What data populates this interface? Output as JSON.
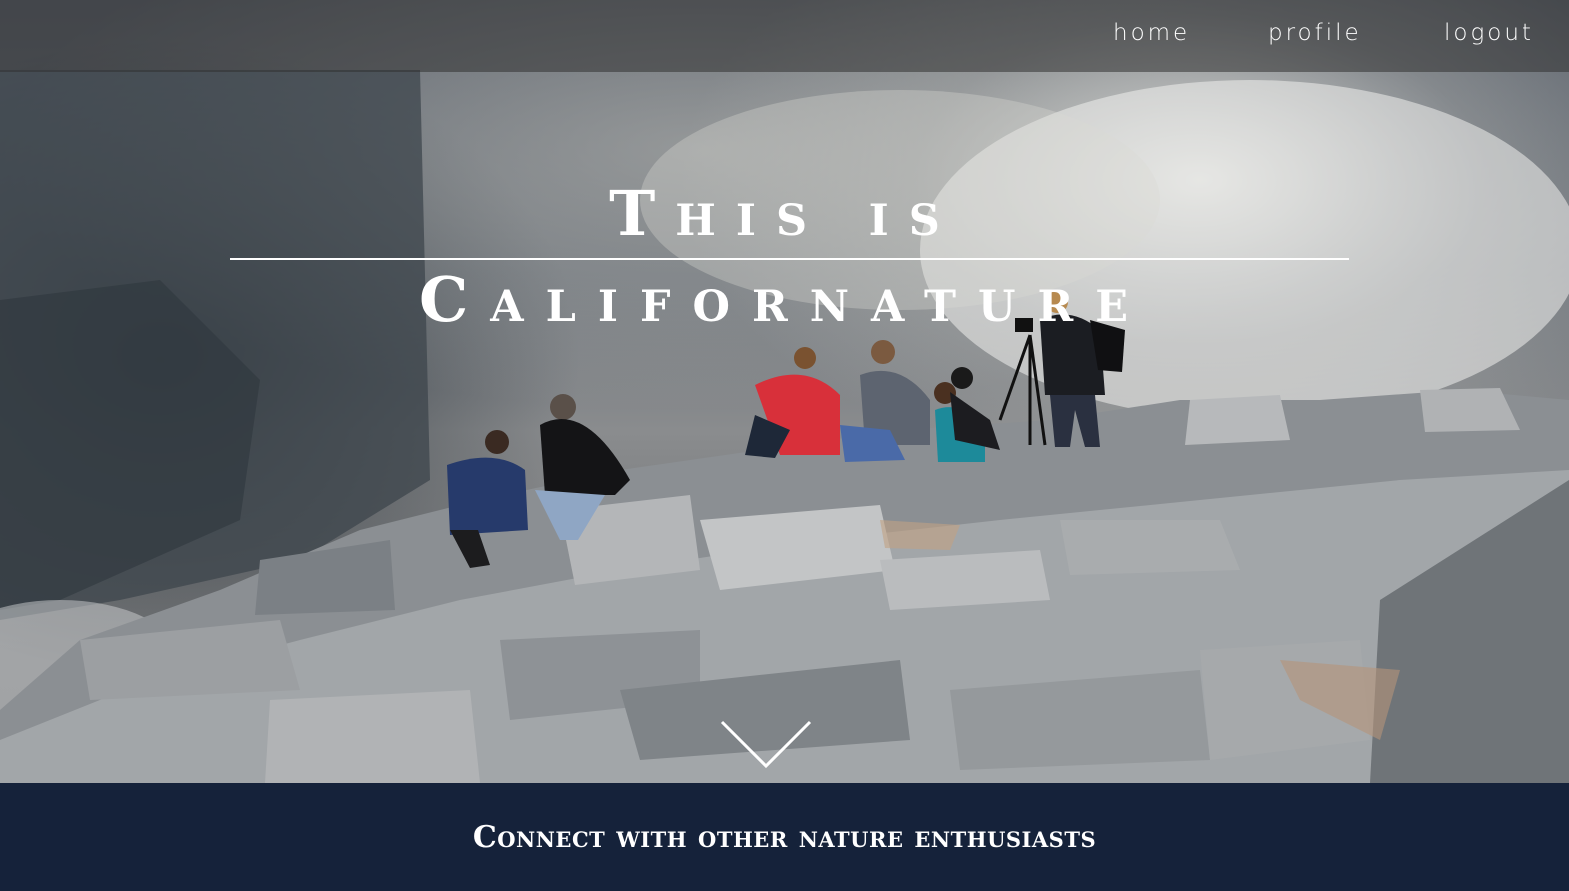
{
  "nav": {
    "home": "home",
    "profile": "profile",
    "logout": "logout"
  },
  "hero": {
    "title_line1": "This is",
    "title_line2": "Californature"
  },
  "tagline": "Connect with other nature enthusiasts",
  "colors": {
    "band": "#15223a",
    "nav_bg": "rgba(50,50,50,0.55)",
    "text": "#ffffff"
  },
  "icons": {
    "scroll": "chevron-down-icon"
  }
}
